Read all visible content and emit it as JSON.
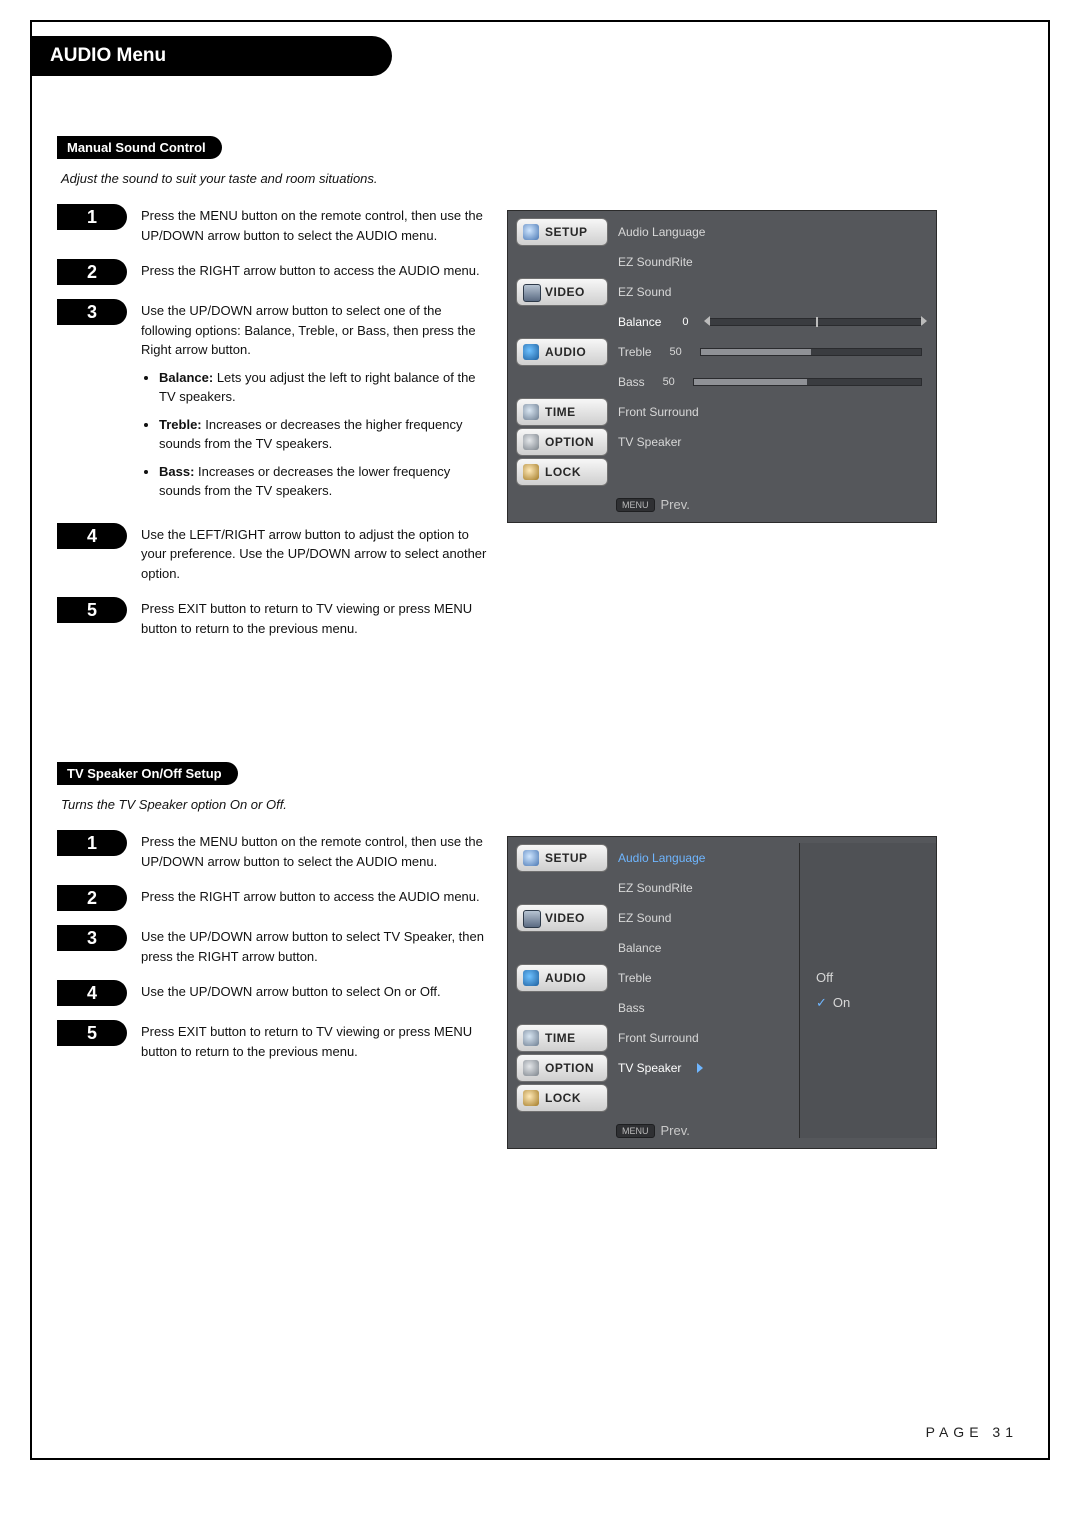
{
  "page_title": "AUDIO Menu",
  "page_number": "PAGE 31",
  "osd": {
    "tabs": [
      "SETUP",
      "VIDEO",
      "AUDIO",
      "TIME",
      "OPTION",
      "LOCK"
    ],
    "items": [
      "Audio Language",
      "EZ SoundRite",
      "EZ Sound",
      "Balance",
      "Treble",
      "Bass",
      "Front Surround",
      "TV Speaker"
    ],
    "balance_val": "0",
    "treble_val": "50",
    "bass_val": "50",
    "prev_key": "MENU",
    "prev_label": "Prev.",
    "submenu": {
      "off": "Off",
      "on": "On"
    }
  },
  "section1": {
    "heading": "Manual Sound Control",
    "desc": "Adjust the sound to suit your taste and room situations.",
    "steps": [
      {
        "n": "1",
        "text": "Press the MENU button on the remote control, then use the UP/DOWN arrow button to select the AUDIO menu."
      },
      {
        "n": "2",
        "text": "Press the RIGHT arrow button to access the AUDIO menu."
      },
      {
        "n": "3",
        "text": "Use the UP/DOWN arrow button to select one of the following options: Balance, Treble, or Bass, then press the Right arrow button.",
        "bullets": [
          {
            "b": "Balance:",
            "t": " Lets you adjust the left to right balance of the TV speakers."
          },
          {
            "b": "Treble:",
            "t": " Increases or decreases the higher frequency sounds from the TV speakers."
          },
          {
            "b": "Bass:",
            "t": " Increases or decreases the lower frequency sounds from the TV speakers."
          }
        ]
      },
      {
        "n": "4",
        "text": "Use the LEFT/RIGHT arrow button to adjust the option to your preference. Use the UP/DOWN arrow to select another option."
      },
      {
        "n": "5",
        "text": "Press EXIT button to return to TV viewing or press MENU button to return to the previous menu."
      }
    ]
  },
  "section2": {
    "heading": "TV Speaker On/Off Setup",
    "desc": "Turns the TV Speaker option On or Off.",
    "steps": [
      {
        "n": "1",
        "text": "Press the MENU button on the remote control, then use the UP/DOWN arrow button to select the AUDIO menu."
      },
      {
        "n": "2",
        "text": "Press the RIGHT arrow button to access the AUDIO menu."
      },
      {
        "n": "3",
        "text": "Use the UP/DOWN arrow button to select TV Speaker, then press the RIGHT arrow button."
      },
      {
        "n": "4",
        "text": "Use the UP/DOWN arrow button to select On or Off."
      },
      {
        "n": "5",
        "text": "Press EXIT button to return to TV viewing or press MENU button to return to the previous menu."
      }
    ]
  }
}
